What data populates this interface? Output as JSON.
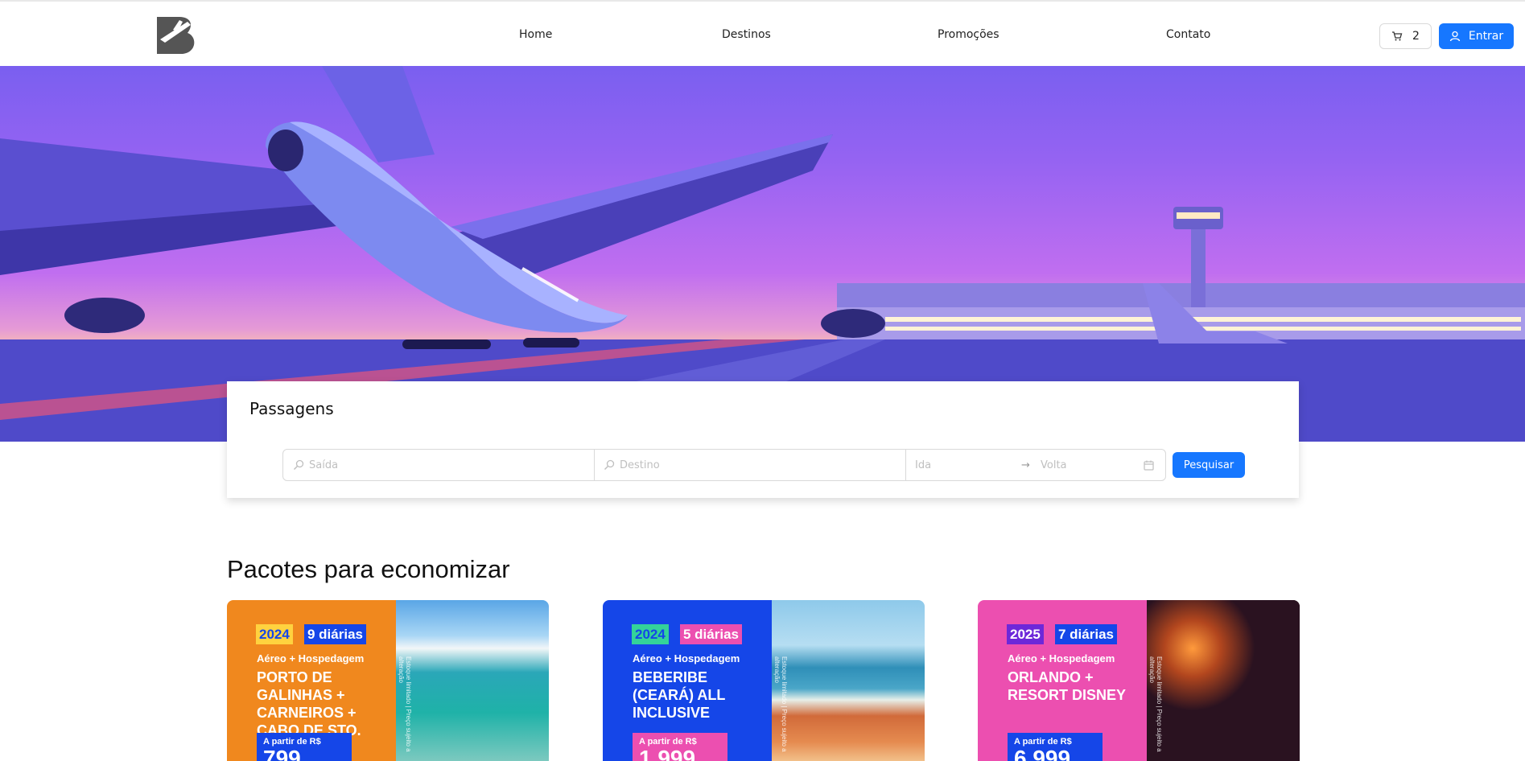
{
  "header": {
    "nav": [
      {
        "label": "Home"
      },
      {
        "label": "Destinos"
      },
      {
        "label": "Promoções"
      },
      {
        "label": "Contato"
      }
    ],
    "cart": {
      "icon": "cart-icon",
      "count": "2"
    },
    "login": {
      "icon": "user-icon",
      "label": "Entrar"
    }
  },
  "search": {
    "title": "Passagens",
    "origin_placeholder": "Saída",
    "destination_placeholder": "Destino",
    "departure_placeholder": "Ida",
    "return_placeholder": "Volta",
    "button_label": "Pesquisar"
  },
  "packages": {
    "title": "Pacotes para economizar",
    "items": [
      {
        "year": "2024",
        "days": "9 diárias",
        "subtitle": "Aéreo + Hospedagem",
        "name": "PORTO DE GALINHAS + CARNEIROS + CABO DE STO. AGOSTINHO",
        "price_label": "A partir de R$",
        "price": "799",
        "note": "Estoque limitado | Preço sujeito a alteração",
        "bg": "#f0881e",
        "price_bg": "#1546e8"
      },
      {
        "year": "2024",
        "days": "5 diárias",
        "subtitle": "Aéreo + Hospedagem",
        "name": "BEBERIBE (CEARÁ) ALL INCLUSIVE",
        "price_label": "A partir de R$",
        "price": "1.999",
        "note": "Estoque limitado | Preço sujeito a alteração",
        "bg": "#1546e8",
        "price_bg": "#ec4fb0"
      },
      {
        "year": "2025",
        "days": "7 diárias",
        "subtitle": "Aéreo + Hospedagem",
        "name": "ORLANDO + RESORT DISNEY",
        "price_label": "A partir de R$",
        "price": "6.999",
        "note": "Estoque limitado | Preço sujeito a alteração",
        "bg": "#ec4fb0",
        "price_bg": "#1546e8"
      }
    ]
  },
  "colors": {
    "primary": "#1677ff"
  }
}
